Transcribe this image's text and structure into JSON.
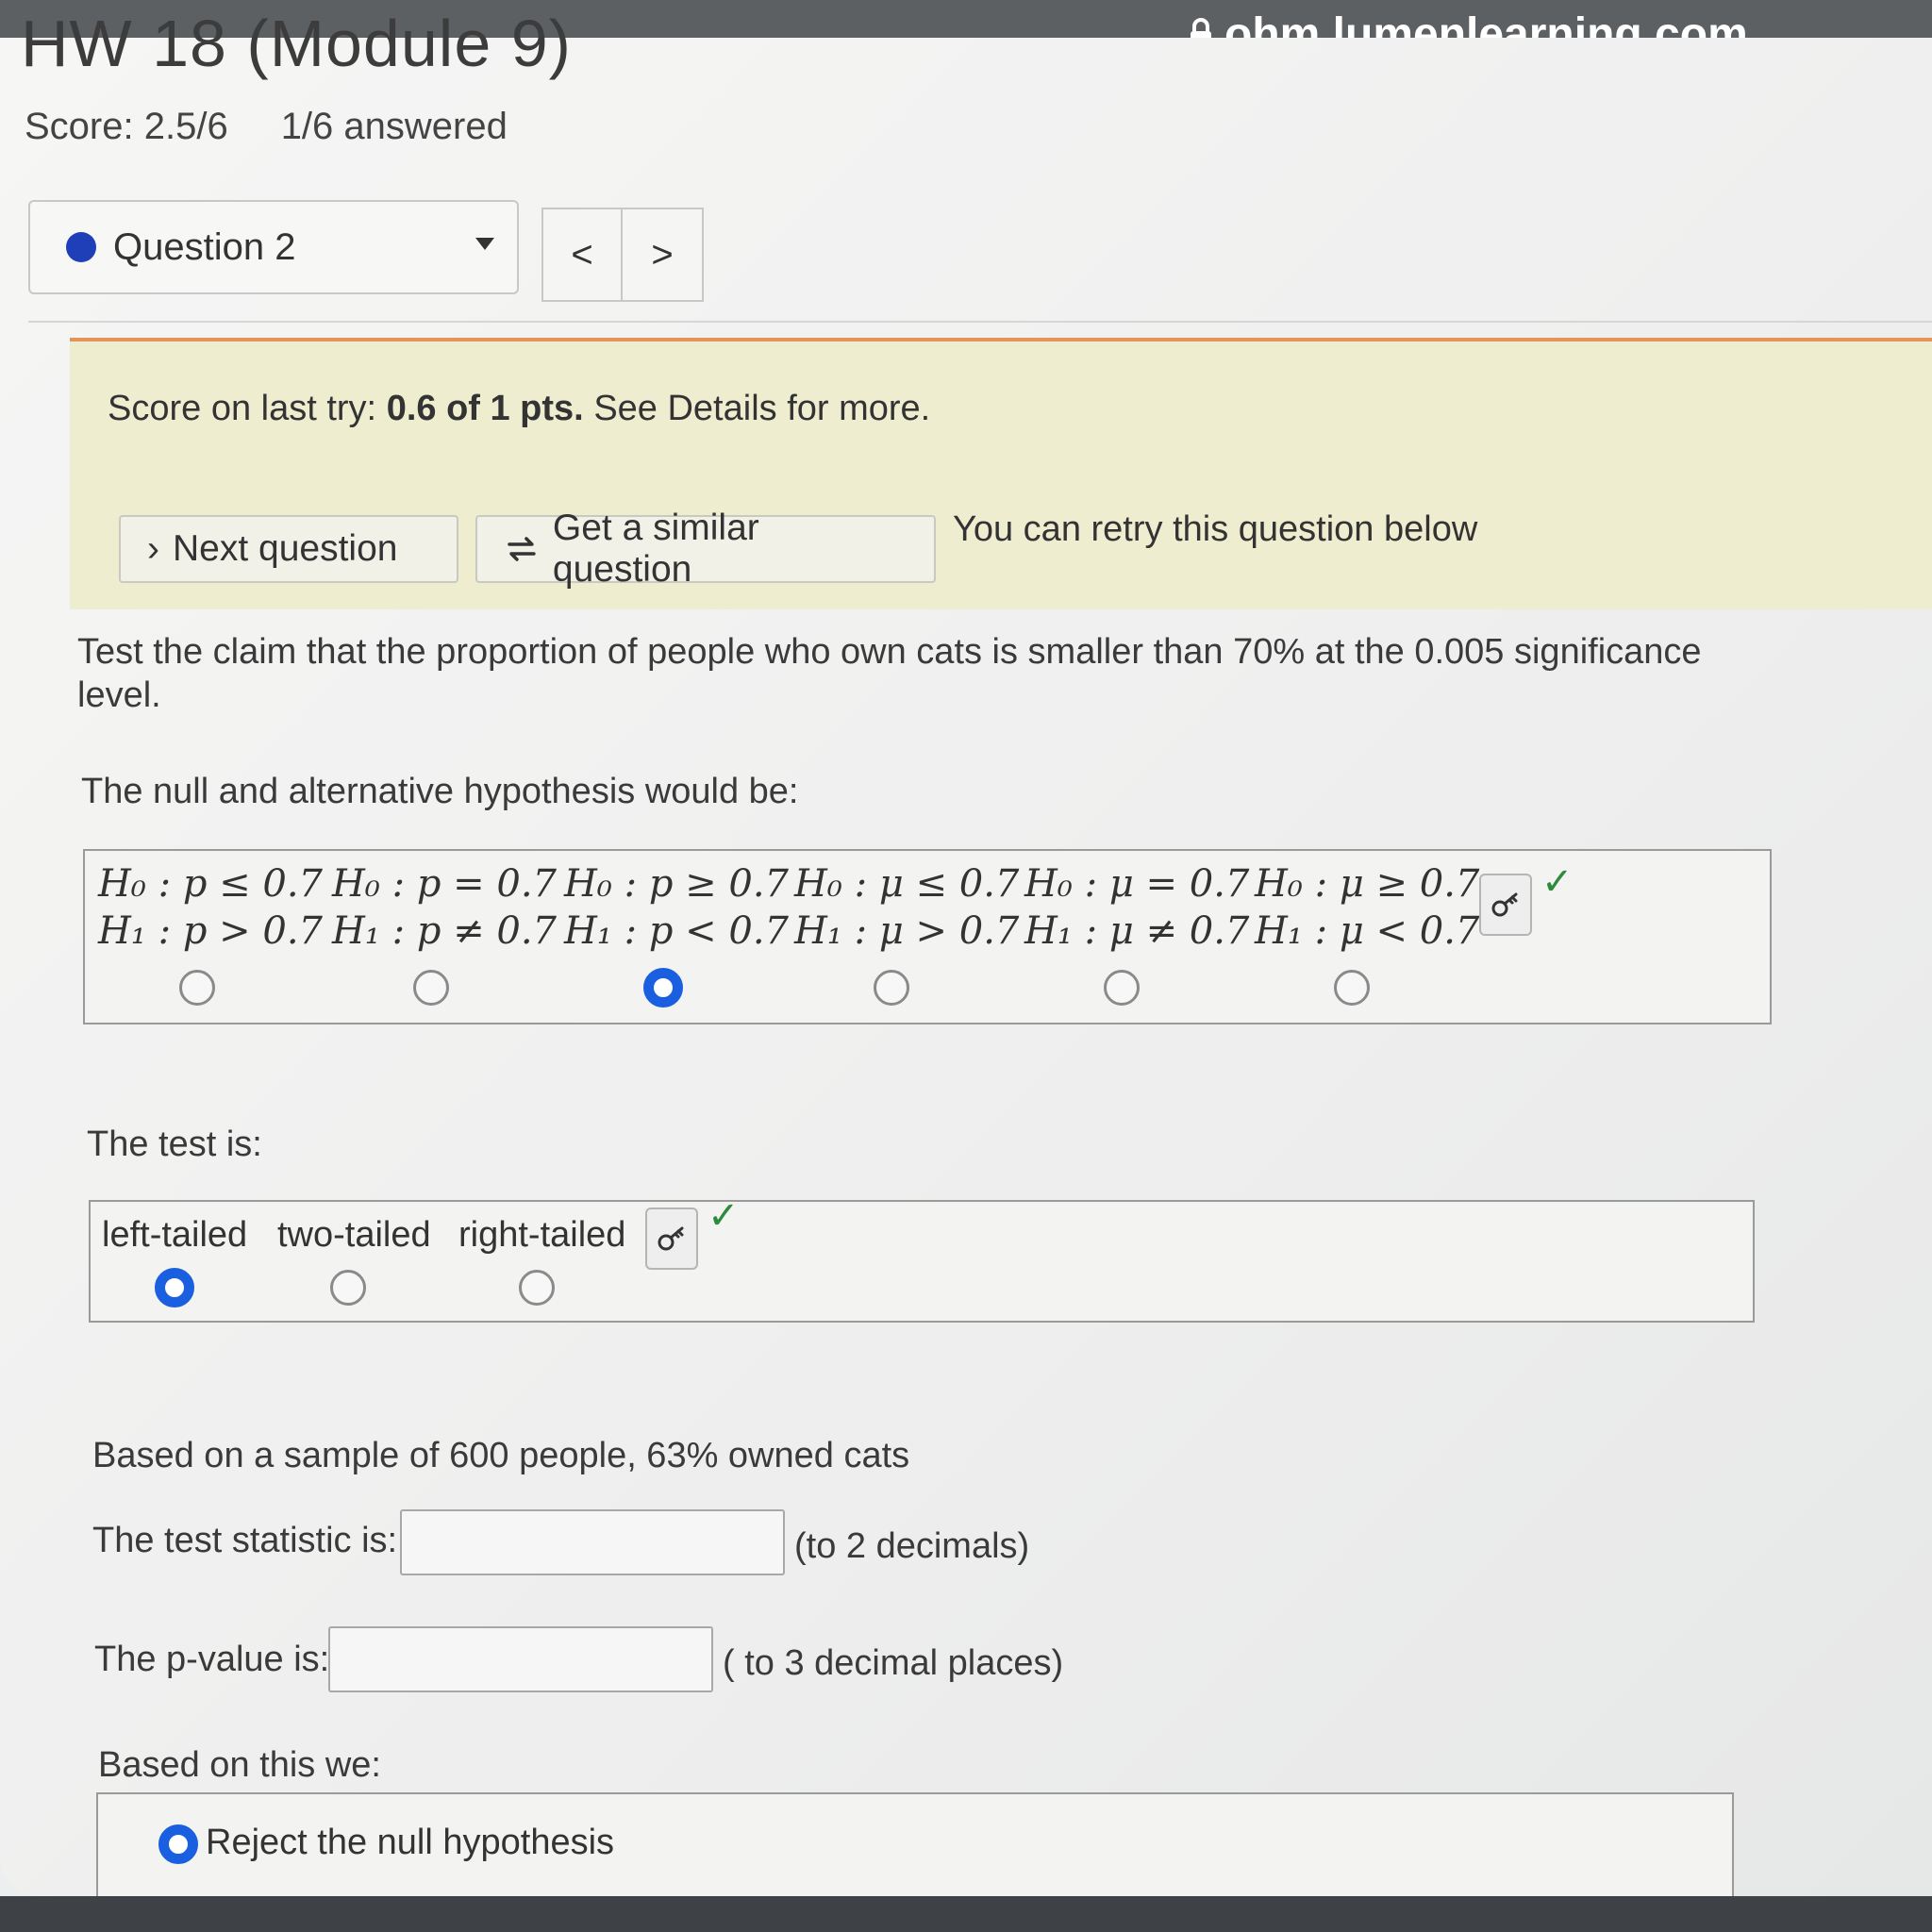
{
  "browser": {
    "url": "ohm.lumenlearning.com"
  },
  "header": {
    "hw_title": "HW 18 (Module 9)",
    "score": "Score: 2.5/6",
    "answered": "1/6 answered"
  },
  "question_nav": {
    "selected": "Question 2",
    "prev": "<",
    "next": ">"
  },
  "banner": {
    "score_prefix": "Score on last try:",
    "score_value": "0.6 of 1 pts.",
    "score_suffix": "See Details for more.",
    "next_button": "Next question",
    "similar_button": "Get a similar question",
    "retry_text": "You can retry this question below"
  },
  "question": {
    "prompt": "Test the claim that the proportion of people who own cats is smaller than 70% at the 0.005 significance level.",
    "hypothesis_label": "The null and alternative hypothesis would be:",
    "hypotheses": [
      {
        "h0": "H₀ : p ≤ 0.7",
        "h1": "H₁ : p > 0.7",
        "selected": false
      },
      {
        "h0": "H₀ : p = 0.7",
        "h1": "H₁ : p ≠ 0.7",
        "selected": false
      },
      {
        "h0": "H₀ : p ≥ 0.7",
        "h1": "H₁ : p < 0.7",
        "selected": true
      },
      {
        "h0": "H₀ : μ ≤ 0.7",
        "h1": "H₁ : μ > 0.7",
        "selected": false
      },
      {
        "h0": "H₀ : μ = 0.7",
        "h1": "H₁ : μ ≠ 0.7",
        "selected": false
      },
      {
        "h0": "H₀ : μ ≥ 0.7",
        "h1": "H₁ : μ < 0.7",
        "selected": false
      }
    ],
    "test_label": "The test is:",
    "tails": [
      {
        "label": "left-tailed",
        "selected": true
      },
      {
        "label": "two-tailed",
        "selected": false
      },
      {
        "label": "right-tailed",
        "selected": false
      }
    ],
    "sample_text": "Based on a sample of 600 people, 63% owned cats",
    "test_statistic_label": "The test statistic is:",
    "test_statistic_value": "",
    "test_statistic_hint": "(to 2 decimals)",
    "pvalue_label": "The p-value is:",
    "pvalue_value": "",
    "pvalue_hint": "( to 3 decimal places)",
    "conclusion_label": "Based on this we:",
    "conclusion_option": "Reject the null hypothesis"
  },
  "colors": {
    "radio_selected": "#1a5fe0",
    "check": "#2e8b3d",
    "banner_bg": "#efedd0",
    "banner_border": "#e6935a"
  }
}
